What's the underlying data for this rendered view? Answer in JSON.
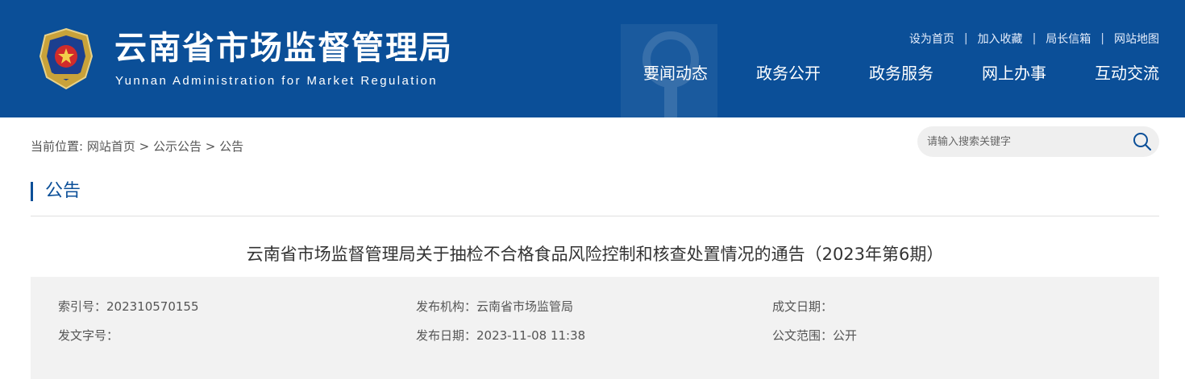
{
  "header": {
    "site_title": "云南省市场监督管理局",
    "site_subtitle": "Yunnan Administration for Market Regulation",
    "top_links": [
      "设为首页",
      "加入收藏",
      "局长信箱",
      "网站地图"
    ],
    "top_link_separator": "|",
    "nav": [
      "要闻动态",
      "政务公开",
      "政务服务",
      "网上办事",
      "互动交流"
    ]
  },
  "breadcrumb": {
    "prefix": "当前位置:",
    "items": [
      "网站首页",
      "公示公告",
      "公告"
    ],
    "separator": ">"
  },
  "search": {
    "placeholder": "请输入搜索关键字",
    "icon": "search-icon"
  },
  "section": {
    "title": "公告"
  },
  "article": {
    "title": "云南省市场监督管理局关于抽检不合格食品风险控制和核查处置情况的通告（2023年第6期）"
  },
  "meta": {
    "index_no": "索引号：202310570155",
    "publisher": "发布机构：云南省市场监管局",
    "written_date": "成文日期：",
    "doc_no": "发文字号：",
    "publish_date": "发布日期：2023-11-08 11:38",
    "scope": "公文范围：公开"
  },
  "colors": {
    "brand_blue": "#0b4f98",
    "meta_bg": "#f2f2f2",
    "search_bg": "#efefef"
  }
}
